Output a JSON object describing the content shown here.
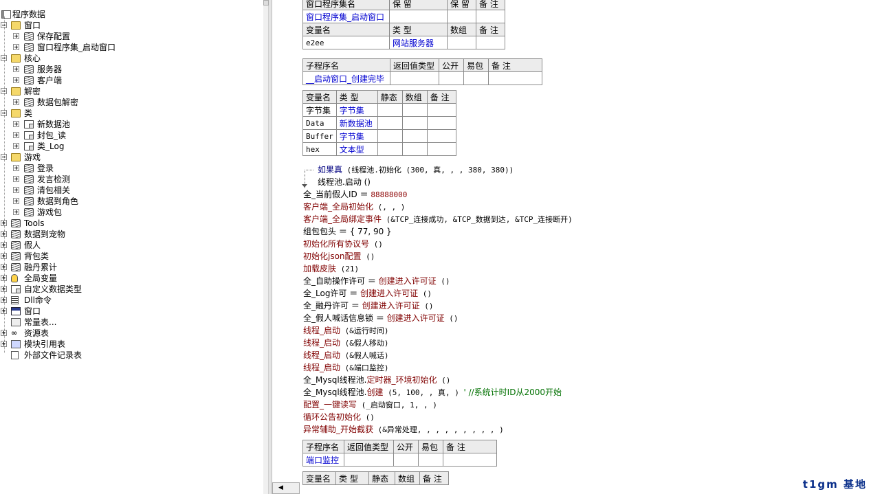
{
  "tree": {
    "root": "程序数据",
    "items": [
      {
        "label": "窗口",
        "level": 0,
        "icon": "folder-icon",
        "expanded": true
      },
      {
        "label": "保存配置",
        "level": 1,
        "icon": "stack-icon"
      },
      {
        "label": "窗口程序集_启动窗口",
        "level": 1,
        "icon": "stack-icon"
      },
      {
        "label": "核心",
        "level": 0,
        "icon": "folder-icon",
        "expanded": true
      },
      {
        "label": "服务器",
        "level": 1,
        "icon": "stack-icon"
      },
      {
        "label": "客户端",
        "level": 1,
        "icon": "stack-icon"
      },
      {
        "label": "解密",
        "level": 0,
        "icon": "folder-icon",
        "expanded": true
      },
      {
        "label": "数据包解密",
        "level": 1,
        "icon": "stack-icon"
      },
      {
        "label": "类",
        "level": 0,
        "icon": "folder-icon",
        "expanded": true
      },
      {
        "label": "新数据池",
        "level": 1,
        "icon": "class-icon"
      },
      {
        "label": "封包_读",
        "level": 1,
        "icon": "class-icon"
      },
      {
        "label": "类_Log",
        "level": 1,
        "icon": "class-icon"
      },
      {
        "label": "游戏",
        "level": 0,
        "icon": "folder-icon",
        "expanded": true
      },
      {
        "label": "登录",
        "level": 1,
        "icon": "stack-icon"
      },
      {
        "label": "发言检测",
        "level": 1,
        "icon": "stack-icon"
      },
      {
        "label": "清包相关",
        "level": 1,
        "icon": "stack-icon"
      },
      {
        "label": "数据到角色",
        "level": 1,
        "icon": "stack-icon"
      },
      {
        "label": "游戏包",
        "level": 1,
        "icon": "stack-icon"
      },
      {
        "label": "Tools",
        "level": 0,
        "icon": "stack-icon",
        "expanded": false
      },
      {
        "label": "数据到宠物",
        "level": 0,
        "icon": "stack-icon",
        "expanded": false
      },
      {
        "label": "假人",
        "level": 0,
        "icon": "stack-icon",
        "expanded": false
      },
      {
        "label": "背包类",
        "level": 0,
        "icon": "stack-icon",
        "expanded": false
      },
      {
        "label": "融丹累计",
        "level": 0,
        "icon": "stack-icon",
        "expanded": false
      },
      {
        "label": "全局变量",
        "level": 0,
        "icon": "database-icon",
        "expanded": false
      },
      {
        "label": "自定义数据类型",
        "level": 0,
        "icon": "class-icon",
        "expanded": false
      },
      {
        "label": "Dll命令",
        "level": 0,
        "icon": "dll-icon",
        "expanded": false
      },
      {
        "label": "窗口",
        "level": 0,
        "icon": "window-icon",
        "expanded": false
      },
      {
        "label": "常量表...",
        "level": 0,
        "icon": "constant-icon",
        "expanded": null
      },
      {
        "label": "资源表",
        "level": 0,
        "icon": "resource-icon",
        "expanded": false
      },
      {
        "label": "模块引用表",
        "level": 0,
        "icon": "module-icon",
        "expanded": false
      },
      {
        "label": "外部文件记录表",
        "level": 0,
        "icon": "file-icon",
        "expanded": null
      }
    ]
  },
  "assembly_table": {
    "headers": [
      "窗口程序集名",
      "保 留",
      "保 留",
      "备 注"
    ],
    "row": [
      "窗口程序集_启动窗口",
      "",
      "",
      ""
    ]
  },
  "assembly_var_table": {
    "headers": [
      "变量名",
      "类 型",
      "数组",
      "备 注"
    ],
    "row": [
      "e2ee",
      "网站服务器",
      "",
      ""
    ]
  },
  "sub_table": {
    "headers": [
      "子程序名",
      "返回值类型",
      "公开",
      "易包",
      "备 注"
    ],
    "row": [
      "__启动窗口_创建完毕",
      "",
      "",
      "",
      ""
    ]
  },
  "local_var_table": {
    "headers": [
      "变量名",
      "类 型",
      "静态",
      "数组",
      "备 注"
    ],
    "rows": [
      [
        "字节集",
        "字节集",
        "",
        "",
        ""
      ],
      [
        "Data",
        "新数据池",
        "",
        "",
        ""
      ],
      [
        "Buffer",
        "字节集",
        "",
        "",
        ""
      ],
      [
        "hex",
        "文本型",
        "",
        "",
        ""
      ]
    ]
  },
  "code_lines": {
    "l1": {
      "a": "如果真",
      "b": " (线程池.初始化 (300, 真, , , 380, 380))"
    },
    "l2": {
      "a": "线程池.启动 ()"
    },
    "l3": {
      "a": "全_当前假人ID ＝ ",
      "b": "88888000"
    },
    "l4": {
      "a": "客户端_全局初始化",
      "b": " (, , )"
    },
    "l5": {
      "a": "客户端_全局绑定事件",
      "b": " (&TCP_连接成功, &TCP_数据到达, &TCP_连接断开)"
    },
    "l6": {
      "a": "组包包头 ＝ { 77, 90 }"
    },
    "l7": {
      "a": "初始化所有协议号",
      "b": " ()"
    },
    "l8": {
      "a": "初始化json配置",
      "b": " ()"
    },
    "l9": {
      "a": "加载皮肤",
      "b": " (21)"
    },
    "l10": {
      "a": "全_自助操作许可 ＝ ",
      "b": "创建进入许可证",
      "c": " ()"
    },
    "l11": {
      "a": "全_Log许可 ＝ ",
      "b": "创建进入许可证",
      "c": " ()"
    },
    "l12": {
      "a": "全_融丹许可 ＝ ",
      "b": "创建进入许可证",
      "c": " ()"
    },
    "l13": {
      "a": "全_假人喊话信息锁 ＝ ",
      "b": "创建进入许可证",
      "c": " ()"
    },
    "l14": {
      "a": "线程_启动",
      "b": " (&运行时间)"
    },
    "l15": {
      "a": "线程_启动",
      "b": " (&假人移动)"
    },
    "l16": {
      "a": "线程_启动",
      "b": " (&假人喊话)"
    },
    "l17": {
      "a": "线程_启动",
      "b": " (&端口监控)"
    },
    "l18": {
      "a": "全_Mysql线程池.",
      "b": "定时器_环境初始化",
      "c": " ()"
    },
    "l19": {
      "a": "全_Mysql线程池.",
      "b": "创建",
      "c": " (5, 100, , 真, ) ",
      "d": "' //系统计时ID从2000开始"
    },
    "l20": {
      "a": "配置_一键读写",
      "b": " (_启动窗口, 1, , )"
    },
    "l21": {
      "a": "循环公告初始化",
      "b": " ()"
    },
    "l22": {
      "a": "异常辅助_开始截获",
      "b": " (&异常处理, , , , , , , , , )"
    }
  },
  "sub_table2": {
    "headers": [
      "子程序名",
      "返回值类型",
      "公开",
      "易包",
      "备 注"
    ],
    "row": [
      "端口监控",
      "",
      "",
      "",
      ""
    ]
  },
  "local_var_table2": {
    "headers": [
      "变量名",
      "类 型",
      "静态",
      "数组",
      "备 注"
    ]
  },
  "watermark": "t1gm 基地"
}
